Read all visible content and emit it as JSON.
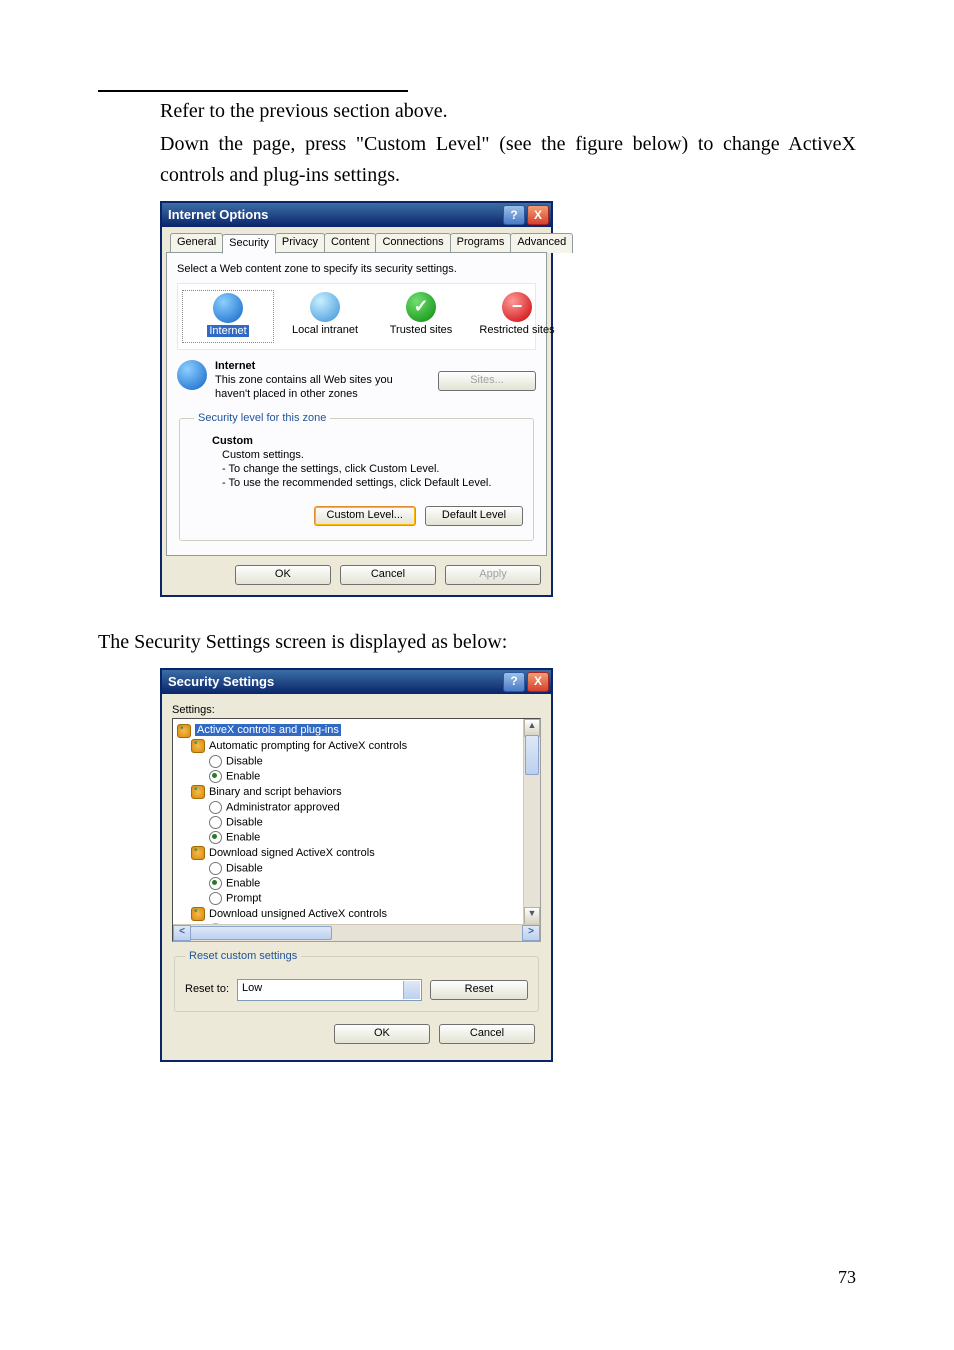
{
  "intro": {
    "line1": "Refer to the previous section above.",
    "para": "Down the page, press \"Custom Level\" (see the figure below) to change ActiveX controls and plug-ins settings."
  },
  "dialog1": {
    "title": "Internet Options",
    "help": "?",
    "close": "X",
    "tabs": [
      "General",
      "Security",
      "Privacy",
      "Content",
      "Connections",
      "Programs",
      "Advanced"
    ],
    "active_tab_idx": 1,
    "hint": "Select a Web content zone to specify its security settings.",
    "zones": [
      "Internet",
      "Local intranet",
      "Trusted sites",
      "Restricted sites"
    ],
    "zone_selected_idx": 0,
    "zone_name": "Internet",
    "zone_desc1": "This zone contains all Web sites you",
    "zone_desc2": "haven't placed in other zones",
    "sites_btn": "Sites...",
    "group_legend": "Security level for this zone",
    "level_heading": "Custom",
    "level_line1": "Custom settings.",
    "level_line2": "- To change the settings, click Custom Level.",
    "level_line3": "- To use the recommended settings, click Default Level.",
    "custom_btn": "Custom Level...",
    "default_btn": "Default Level",
    "ok": "OK",
    "cancel": "Cancel",
    "apply": "Apply"
  },
  "mid_para": "The Security Settings screen is displayed as below:",
  "dialog2": {
    "title": "Security Settings",
    "help": "?",
    "close": "X",
    "settings_label": "Settings:",
    "tree": {
      "root": "ActiveX controls and plug-ins",
      "g1": "Automatic prompting for ActiveX controls",
      "g1o": [
        "Disable",
        "Enable"
      ],
      "g1sel": 1,
      "g2": "Binary and script behaviors",
      "g2o": [
        "Administrator approved",
        "Disable",
        "Enable"
      ],
      "g2sel": 2,
      "g3": "Download signed ActiveX controls",
      "g3o": [
        "Disable",
        "Enable",
        "Prompt"
      ],
      "g3sel": 1,
      "g4": "Download unsigned ActiveX controls",
      "g4o_cut": "Disable"
    },
    "reset_legend": "Reset custom settings",
    "reset_to_label": "Reset to:",
    "reset_combo": "Low",
    "reset_btn": "Reset",
    "ok": "OK",
    "cancel": "Cancel"
  },
  "page_number": "73"
}
